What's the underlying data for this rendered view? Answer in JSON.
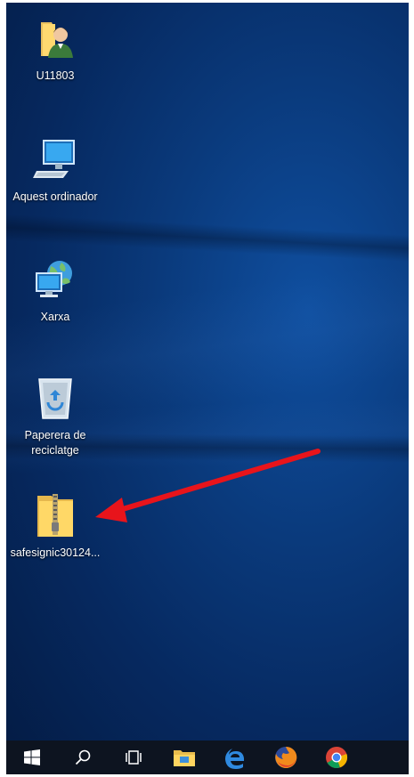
{
  "desktop": {
    "icons": [
      {
        "label": "U11803",
        "icon": "user-folder-icon"
      },
      {
        "label": "Aquest ordinador",
        "icon": "computer-icon"
      },
      {
        "label": "Xarxa",
        "icon": "network-icon"
      },
      {
        "label": "Paperera de\nreciclatge",
        "icon": "recycle-bin-icon"
      },
      {
        "label": "safesignic30124...",
        "icon": "zip-folder-icon"
      }
    ]
  },
  "taskbar": {
    "items": [
      "start-icon",
      "search-icon",
      "task-view-icon",
      "file-explorer-icon",
      "edge-icon",
      "firefox-icon",
      "chrome-icon"
    ]
  },
  "annotation": {
    "type": "red-arrow",
    "color": "#e8141b"
  }
}
